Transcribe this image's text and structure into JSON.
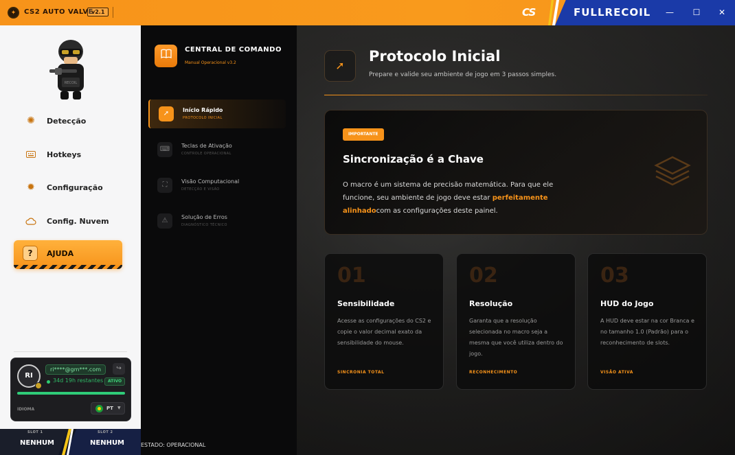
{
  "titlebar": {
    "app_title": "CS2 AUTO VALVE",
    "version": "v2.1",
    "brand_left": "CS",
    "brand_right": "FULLRECOIL",
    "minimize": "—",
    "maximize": "☐",
    "close": "✕"
  },
  "sidebar": {
    "items": [
      {
        "label": "Detecção",
        "icon": "sun-icon"
      },
      {
        "label": "Hotkeys",
        "icon": "keyboard-icon"
      },
      {
        "label": "Configuração",
        "icon": "gear-icon"
      },
      {
        "label": "Config. Nuvem",
        "icon": "cloud-icon"
      }
    ],
    "help": {
      "label": "AJUDA",
      "icon": "?"
    }
  },
  "user": {
    "initials": "RI",
    "email": "ri****@gm***.com",
    "remaining": "34d 19h restantes",
    "status": "ATIVO",
    "progress": 1.0,
    "language_label": "IDIOMA",
    "language": "PT"
  },
  "slots": [
    {
      "label": "SLOT 1",
      "value": "NENHUM"
    },
    {
      "label": "SLOT 2",
      "value": "NENHUM"
    }
  ],
  "command": {
    "title": "CENTRAL DE COMANDO",
    "subtitle": "Manual Operacional v3.2",
    "items": [
      {
        "title": "Início Rápido",
        "sub": "PROTOCOLO INICIAL",
        "icon": "🚀"
      },
      {
        "title": "Teclas de Ativação",
        "sub": "CONTROLE OPERACIONAL",
        "icon": "⌨"
      },
      {
        "title": "Visão Computacional",
        "sub": "DETECÇÃO E VISÃO",
        "icon": "⛶"
      },
      {
        "title": "Solução de Erros",
        "sub": "DIAGNÓSTICO TÉCNICO",
        "icon": "⚠"
      }
    ],
    "status": "ESTADO: OPERACIONAL"
  },
  "main": {
    "title": "Protocolo Inicial",
    "subtitle": "Prepare e valide seu ambiente de jogo em 3 passos simples.",
    "important": {
      "badge": "IMPORTANTE",
      "title": "Sincronização é a Chave",
      "body_1": "O macro é um sistema de precisão matemática. Para que ele funcione, seu ambiente de jogo deve estar ",
      "body_highlight": "perfeitamente alinhado",
      "body_2": "com as configurações deste painel."
    },
    "steps": [
      {
        "num": "01",
        "title": "Sensibilidade",
        "body": "Acesse as configurações do CS2 e copie o valor decimal exato da sensibilidade do mouse.",
        "foot": "SINCRONIA TOTAL"
      },
      {
        "num": "02",
        "title": "Resolução",
        "body": "Garanta que a resolução selecionada no macro seja a mesma que você utiliza dentro do jogo.",
        "foot": "RECONHECIMENTO"
      },
      {
        "num": "03",
        "title": "HUD do Jogo",
        "body": "A HUD deve estar na cor Branca e no tamanho 1.0 (Padrão) para o reconhecimento de slots.",
        "foot": "VISÃO ATIVA"
      }
    ]
  },
  "colors": {
    "accent": "#f7931a",
    "brand_blue": "#1a3aa8",
    "success": "#2fcc78"
  }
}
